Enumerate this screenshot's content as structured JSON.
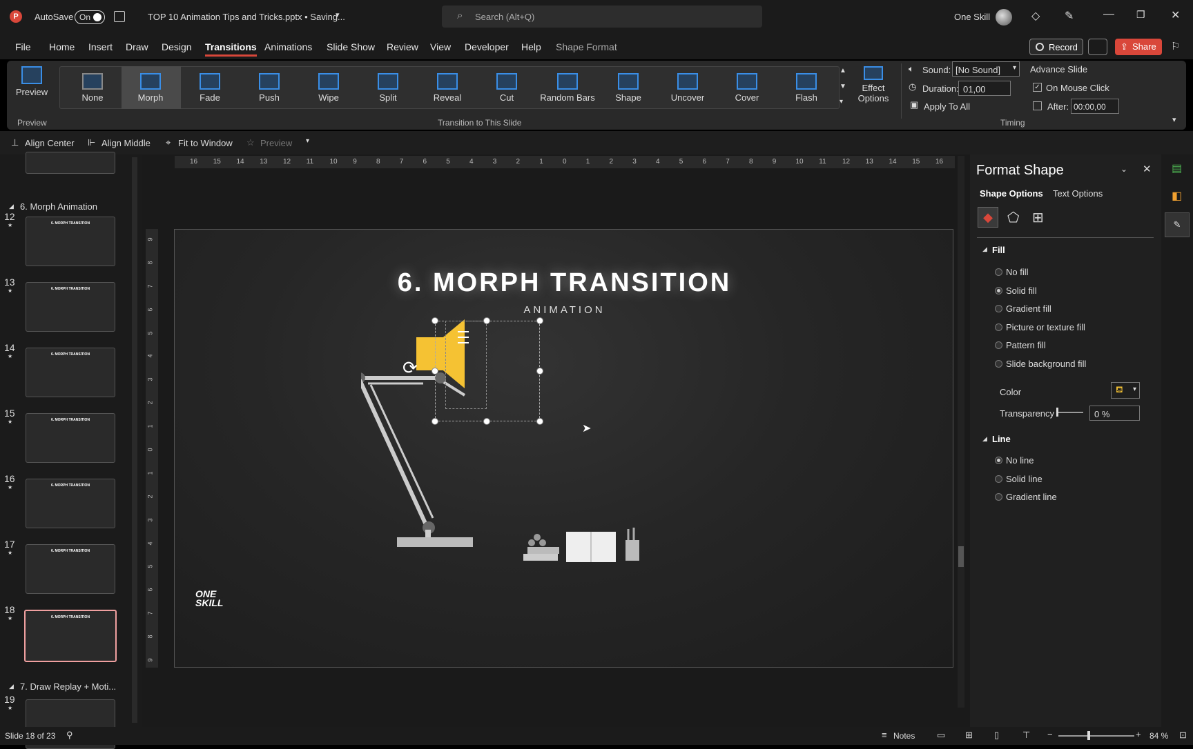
{
  "titlebar": {
    "app_icon": "powerpoint-logo",
    "autosave_label": "AutoSave",
    "toggle_label": "On",
    "filename": "TOP 10 Animation Tips and Tricks.pptx • Saving...",
    "search_placeholder": "Search (Alt+Q)",
    "user_name": "One Skill"
  },
  "menu": {
    "tabs": [
      "File",
      "Home",
      "Insert",
      "Draw",
      "Design",
      "Transitions",
      "Animations",
      "Slide Show",
      "Review",
      "View",
      "Developer",
      "Help",
      "Shape Format"
    ],
    "active_tab": "Transitions",
    "record_label": "Record",
    "share_label": "Share"
  },
  "ribbon": {
    "preview_label": "Preview",
    "preview_group": "Preview",
    "transitions": [
      "None",
      "Morph",
      "Fade",
      "Push",
      "Wipe",
      "Split",
      "Reveal",
      "Cut",
      "Random Bars",
      "Shape",
      "Uncover",
      "Cover",
      "Flash"
    ],
    "selected_transition": "Morph",
    "effect_options_label": "Effect Options",
    "group_label": "Transition to This Slide",
    "sound_label": "Sound:",
    "sound_value": "[No Sound]",
    "duration_label": "Duration:",
    "duration_value": "01,00",
    "apply_all_label": "Apply To All",
    "advance_label": "Advance Slide",
    "on_click_label": "On Mouse Click",
    "after_label": "After:",
    "after_value": "00:00,00",
    "timing_group": "Timing"
  },
  "qat": {
    "align_center": "Align Center",
    "align_middle": "Align Middle",
    "fit_window": "Fit to Window",
    "preview": "Preview"
  },
  "slides": {
    "section6": "6. Morph Animation",
    "section7": "7. Draw Replay + Moti...",
    "numbers": [
      "12",
      "13",
      "14",
      "15",
      "16",
      "17",
      "18",
      "19"
    ],
    "thumb_title": "6. MORPH TRANSITION",
    "active": "18"
  },
  "slide": {
    "title": "6. MORPH TRANSITION",
    "subtitle": "ANIMATION",
    "logo_line1": "ONE",
    "logo_line2": "SKILL"
  },
  "ruler": {
    "top": [
      "16",
      "15",
      "14",
      "13",
      "12",
      "11",
      "10",
      "9",
      "8",
      "7",
      "6",
      "5",
      "4",
      "3",
      "2",
      "1",
      "0",
      "1",
      "2",
      "3",
      "4",
      "5",
      "6",
      "7",
      "8",
      "9",
      "10",
      "11",
      "12",
      "13",
      "14",
      "15",
      "16"
    ],
    "left": [
      "9",
      "8",
      "7",
      "6",
      "5",
      "4",
      "3",
      "2",
      "1",
      "0",
      "1",
      "2",
      "3",
      "4",
      "5",
      "6",
      "7",
      "8",
      "9"
    ]
  },
  "format_pane": {
    "title": "Format Shape",
    "tab_shape": "Shape Options",
    "tab_text": "Text Options",
    "fill_header": "Fill",
    "fill_options": [
      "No fill",
      "Solid fill",
      "Gradient fill",
      "Picture or texture fill",
      "Pattern fill",
      "Slide background fill"
    ],
    "fill_selected": "Solid fill",
    "color_label": "Color",
    "transparency_label": "Transparency",
    "transparency_value": "0 %",
    "line_header": "Line",
    "line_options": [
      "No line",
      "Solid line",
      "Gradient line"
    ],
    "line_selected": "No line"
  },
  "status": {
    "slide_info": "Slide 18 of 23",
    "notes_label": "Notes",
    "zoom": "84 %"
  },
  "colors": {
    "accent_blue": "#3a8ee6",
    "share_red": "#d9473a",
    "lamp_yellow": "#f5c233",
    "active_thumb_border": "#f0a0a0"
  }
}
